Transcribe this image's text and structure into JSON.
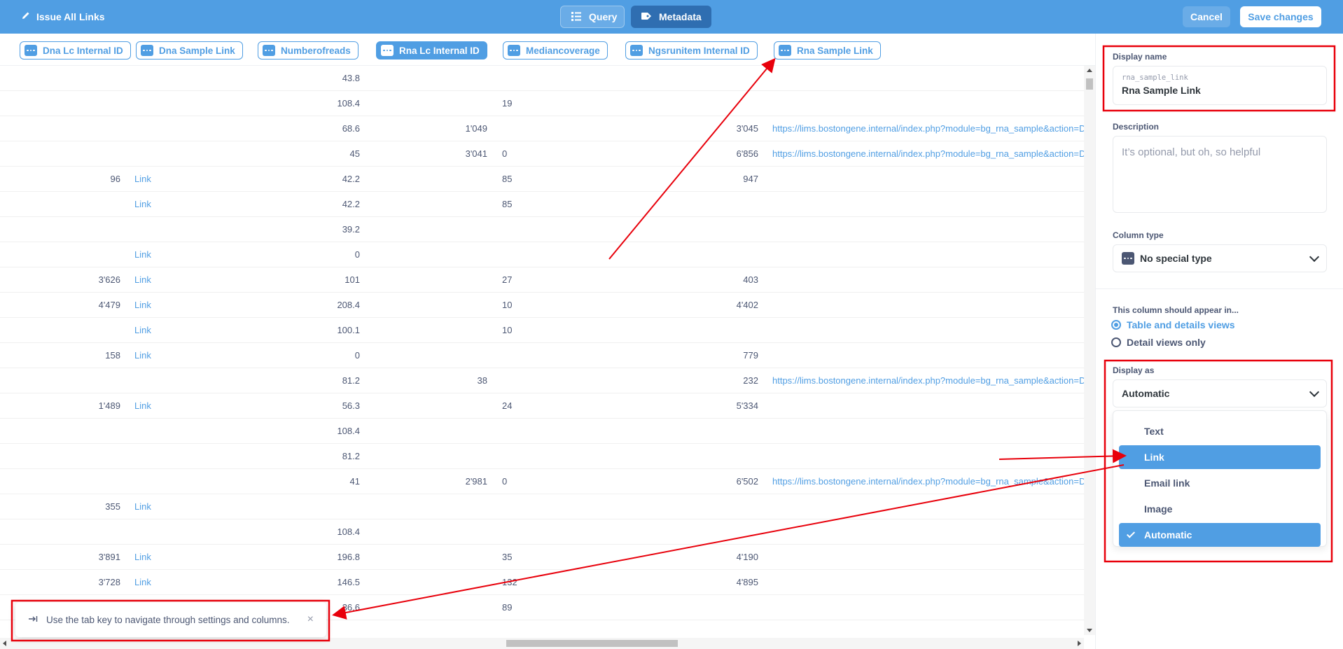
{
  "header": {
    "title": "Issue All Links",
    "query_label": "Query",
    "metadata_label": "Metadata",
    "cancel_label": "Cancel",
    "save_label": "Save changes"
  },
  "columns": [
    {
      "label": "Dna Lc Internal ID",
      "active": false
    },
    {
      "label": "Dna Sample Link",
      "active": false
    },
    {
      "label": "Numberofreads",
      "active": false
    },
    {
      "label": "Rna Lc Internal ID",
      "active": true
    },
    {
      "label": "Mediancoverage",
      "active": false
    },
    {
      "label": "Ngsrunitem Internal ID",
      "active": false
    },
    {
      "label": "Rna Sample Link",
      "active": false
    }
  ],
  "table": {
    "rows": [
      [
        "",
        "",
        "43.8",
        "",
        "",
        "",
        ""
      ],
      [
        "",
        "",
        "108.4",
        "",
        "19",
        "",
        ""
      ],
      [
        "",
        "",
        "68.6",
        "1'049",
        "",
        "3'045",
        "https://lims.bostongene.internal/index.php?module=bg_rna_sample&action=De"
      ],
      [
        "",
        "",
        "45",
        "3'041",
        "0",
        "6'856",
        "https://lims.bostongene.internal/index.php?module=bg_rna_sample&action=De"
      ],
      [
        "96",
        "Link",
        "42.2",
        "",
        "85",
        "947",
        ""
      ],
      [
        "",
        "Link",
        "42.2",
        "",
        "85",
        "",
        ""
      ],
      [
        "",
        "",
        "39.2",
        "",
        "",
        "",
        ""
      ],
      [
        "",
        "Link",
        "0",
        "",
        "",
        "",
        ""
      ],
      [
        "3'626",
        "Link",
        "101",
        "",
        "27",
        "403",
        ""
      ],
      [
        "4'479",
        "Link",
        "208.4",
        "",
        "10",
        "4'402",
        ""
      ],
      [
        "",
        "Link",
        "100.1",
        "",
        "10",
        "",
        ""
      ],
      [
        "158",
        "Link",
        "0",
        "",
        "",
        "779",
        ""
      ],
      [
        "",
        "",
        "81.2",
        "38",
        "",
        "232",
        "https://lims.bostongene.internal/index.php?module=bg_rna_sample&action=De"
      ],
      [
        "1'489",
        "Link",
        "56.3",
        "",
        "24",
        "5'334",
        ""
      ],
      [
        "",
        "",
        "108.4",
        "",
        "",
        "",
        ""
      ],
      [
        "",
        "",
        "81.2",
        "",
        "",
        "",
        ""
      ],
      [
        "",
        "",
        "41",
        "2'981",
        "0",
        "6'502",
        "https://lims.bostongene.internal/index.php?module=bg_rna_sample&action=De"
      ],
      [
        "355",
        "Link",
        "",
        "",
        "",
        "",
        ""
      ],
      [
        "",
        "",
        "108.4",
        "",
        "",
        "",
        ""
      ],
      [
        "3'891",
        "Link",
        "196.8",
        "",
        "35",
        "4'190",
        ""
      ],
      [
        "3'728",
        "Link",
        "146.5",
        "",
        "132",
        "4'895",
        ""
      ],
      [
        "",
        "",
        "36.6",
        "",
        "89",
        "",
        ""
      ]
    ]
  },
  "toast": {
    "text": "Use the tab key to navigate through settings and columns.",
    "close": "×"
  },
  "panel": {
    "display_name_label": "Display name",
    "raw_name": "rna_sample_link",
    "display_name": "Rna Sample Link",
    "description_label": "Description",
    "description_placeholder": "It’s optional, but oh, so helpful",
    "column_type_label": "Column type",
    "column_type_value": "No special type",
    "visibility_label": "This column should appear in...",
    "visibility_option_1": "Table and details views",
    "visibility_option_2": "Detail views only",
    "display_as_label": "Display as",
    "display_as_value": "Automatic",
    "display_as_options": [
      "Text",
      "Link",
      "Email link",
      "Image",
      "Automatic"
    ]
  },
  "colors": {
    "brand": "#509ee3",
    "brand_dark": "#2f6eb1",
    "annotation": "#e8000b",
    "text": "#4c5773"
  }
}
